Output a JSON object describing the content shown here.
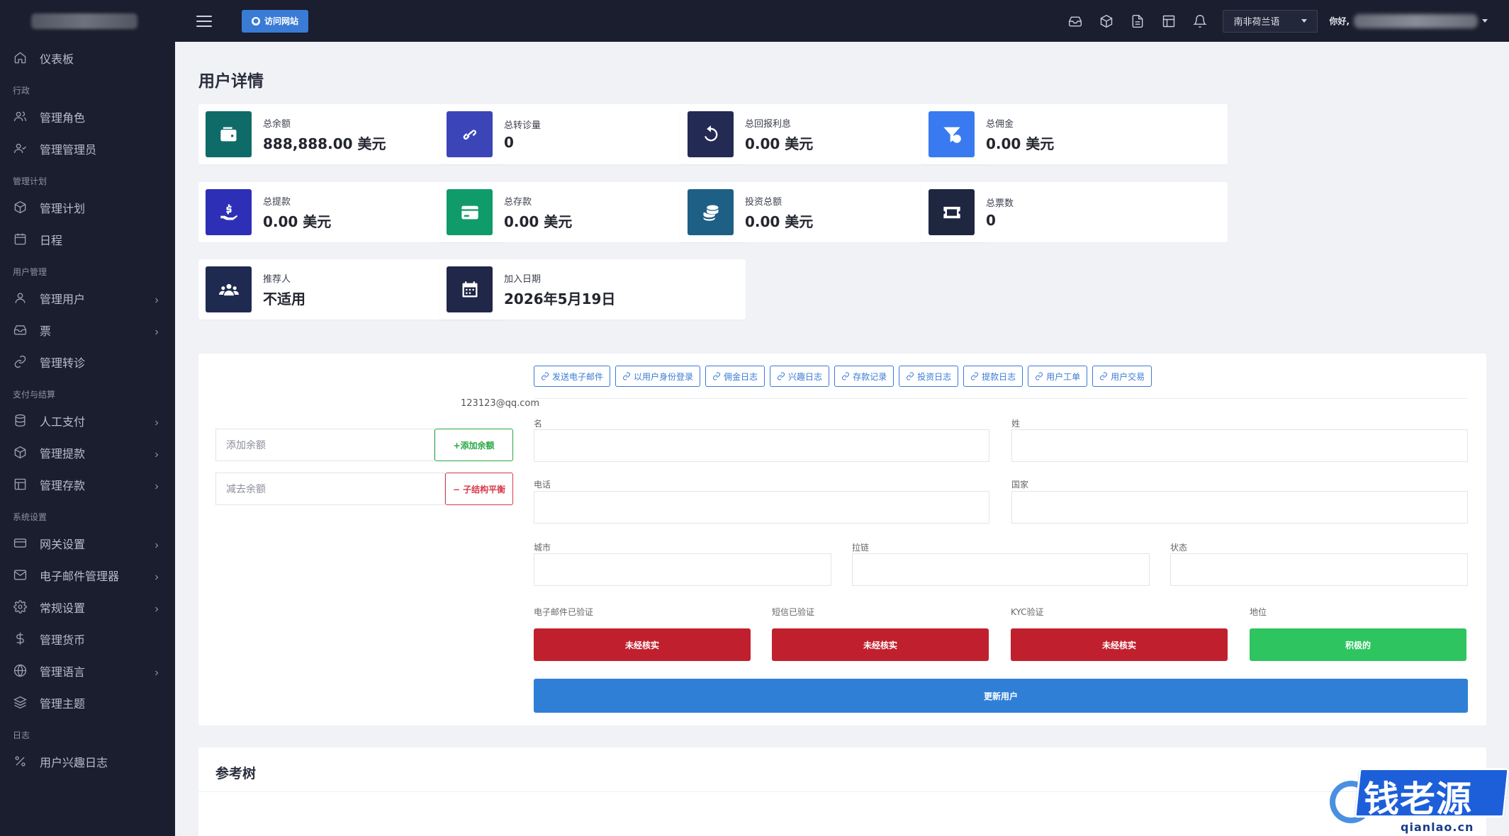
{
  "topbar": {
    "visit_label": "访问网站",
    "language": "南非荷兰语",
    "greeting": "你好,"
  },
  "sidebar": {
    "items": [
      {
        "type": "item",
        "label": "仪表板",
        "icon": "home-icon",
        "chevron": false
      },
      {
        "type": "section",
        "label": "行政"
      },
      {
        "type": "item",
        "label": "管理角色",
        "icon": "users-icon",
        "chevron": false
      },
      {
        "type": "item",
        "label": "管理管理员",
        "icon": "user-check-icon",
        "chevron": false
      },
      {
        "type": "section",
        "label": "管理计划"
      },
      {
        "type": "item",
        "label": "管理计划",
        "icon": "cube-icon",
        "chevron": false
      },
      {
        "type": "item",
        "label": "日程",
        "icon": "calendar-icon",
        "chevron": false
      },
      {
        "type": "section",
        "label": "用户管理"
      },
      {
        "type": "item",
        "label": "管理用户",
        "icon": "user-icon",
        "chevron": true
      },
      {
        "type": "item",
        "label": "票",
        "icon": "inbox-icon",
        "chevron": true
      },
      {
        "type": "item",
        "label": "管理转诊",
        "icon": "link-icon",
        "chevron": false
      },
      {
        "type": "section",
        "label": "支付与结算"
      },
      {
        "type": "item",
        "label": "人工支付",
        "icon": "database-icon",
        "chevron": true
      },
      {
        "type": "item",
        "label": "管理提款",
        "icon": "cube-icon",
        "chevron": true
      },
      {
        "type": "item",
        "label": "管理存款",
        "icon": "layout-icon",
        "chevron": true
      },
      {
        "type": "section",
        "label": "系统设置"
      },
      {
        "type": "item",
        "label": "网关设置",
        "icon": "card-icon",
        "chevron": true
      },
      {
        "type": "item",
        "label": "电子邮件管理器",
        "icon": "mail-icon",
        "chevron": true
      },
      {
        "type": "item",
        "label": "常规设置",
        "icon": "gear-icon",
        "chevron": true
      },
      {
        "type": "item",
        "label": "管理货币",
        "icon": "dollar-icon",
        "chevron": false
      },
      {
        "type": "item",
        "label": "管理语言",
        "icon": "globe-icon",
        "chevron": true
      },
      {
        "type": "item",
        "label": "管理主题",
        "icon": "layers-icon",
        "chevron": false
      },
      {
        "type": "section",
        "label": "日志"
      },
      {
        "type": "item",
        "label": "用户兴趣日志",
        "icon": "percent-icon",
        "chevron": false
      }
    ]
  },
  "page": {
    "title": "用户详情"
  },
  "stats": [
    {
      "label": "总余额",
      "value": "888,888.00 美元",
      "icon": "wallet-icon",
      "color": "#0f6b67"
    },
    {
      "label": "总转诊量",
      "value": "0",
      "icon": "link-icon",
      "color": "#3b45b8"
    },
    {
      "label": "总回报利息",
      "value": "0.00 美元",
      "icon": "undo-icon",
      "color": "#232a54"
    },
    {
      "label": "总佣金",
      "value": "0.00 美元",
      "icon": "funnel-dollar-icon",
      "color": "#3a7af0"
    },
    {
      "label": "总提款",
      "value": "0.00 美元",
      "icon": "hand-dollar-icon",
      "color": "#2d2fb7"
    },
    {
      "label": "总存款",
      "value": "0.00 美元",
      "icon": "credit-card-icon",
      "color": "#109b6a"
    },
    {
      "label": "投资总额",
      "value": "0.00 美元",
      "icon": "coins-icon",
      "color": "#1e5f86"
    },
    {
      "label": "总票数",
      "value": "0",
      "icon": "ticket-icon",
      "color": "#1f2640"
    },
    {
      "label": "推荐人",
      "value": "不适用",
      "icon": "users-group-icon",
      "color": "#1f2a50"
    },
    {
      "label": "加入日期",
      "value": "2026年5月19日",
      "icon": "calendar-icon",
      "color": "#202748"
    }
  ],
  "balance": {
    "email": "123123@qq.com",
    "add_placeholder": "添加余额",
    "add_button": "+添加余额",
    "sub_placeholder": "减去余额",
    "sub_button": "− 子结构平衡"
  },
  "links": [
    "发送电子邮件",
    "以用户身份登录",
    "佣金日志",
    "兴趣日志",
    "存款记录",
    "投资日志",
    "提款日志",
    "用户工单",
    "用户交易"
  ],
  "form": {
    "first_name": "名",
    "last_name": "姓",
    "phone": "电话",
    "country": "国家",
    "city": "城市",
    "zip": "拉链",
    "state": "状态"
  },
  "verify": {
    "email_label": "电子邮件已验证",
    "sms_label": "短信已验证",
    "kyc_label": "KYC验证",
    "status_label": "地位",
    "email_value": "未经核实",
    "sms_value": "未经核实",
    "kyc_value": "未经核实",
    "status_value": "积极的"
  },
  "update_button": "更新用户",
  "ref_tree": {
    "title": "参考树"
  },
  "watermark": {
    "text": "钱老源码",
    "sub": "qianlao.cn"
  }
}
